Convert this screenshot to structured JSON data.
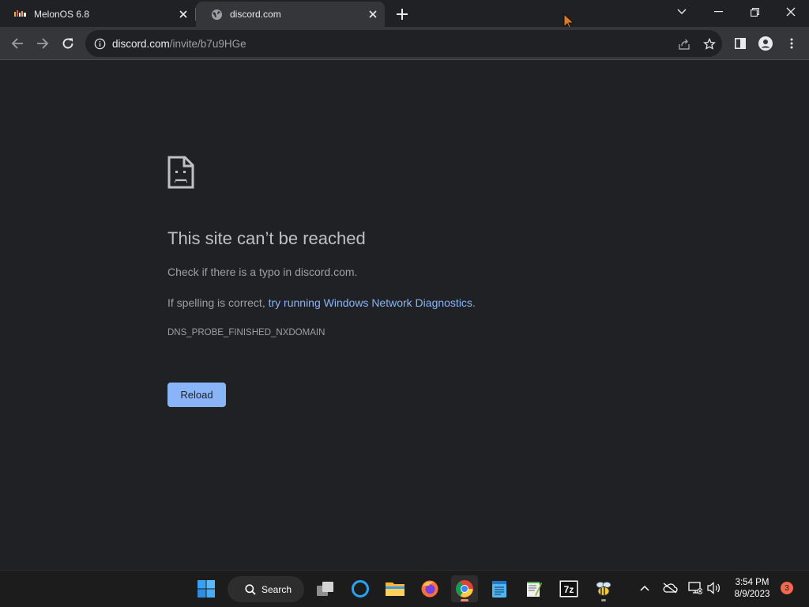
{
  "tabs": [
    {
      "title": "MelonOS 6.8",
      "active": false
    },
    {
      "title": "discord.com",
      "active": true
    }
  ],
  "toolbar": {
    "url_host": "discord.com",
    "url_path": "/invite/b7u9HGe"
  },
  "error": {
    "title": "This site can’t be reached",
    "line1": "Check if there is a typo in discord.com.",
    "line2_prefix": "If spelling is correct, ",
    "line2_link": "try running Windows Network Diagnostics",
    "line2_suffix": ".",
    "code": "DNS_PROBE_FINISHED_NXDOMAIN",
    "reload_label": "Reload"
  },
  "taskbar": {
    "search_label": "Search",
    "time": "3:54 PM",
    "date": "8/9/2023",
    "notification_count": "3",
    "apps": [
      "start",
      "search",
      "task-view",
      "cortana",
      "file-explorer",
      "firefox",
      "chrome",
      "notepad",
      "notepad-plus-plus",
      "7zip",
      "bee-app"
    ]
  },
  "colors": {
    "page_bg": "#202124",
    "toolbar_bg": "#35363a",
    "link": "#8ab4f8",
    "button_bg": "#8ab4f8",
    "taskbar_bg": "#1c1c1c"
  }
}
